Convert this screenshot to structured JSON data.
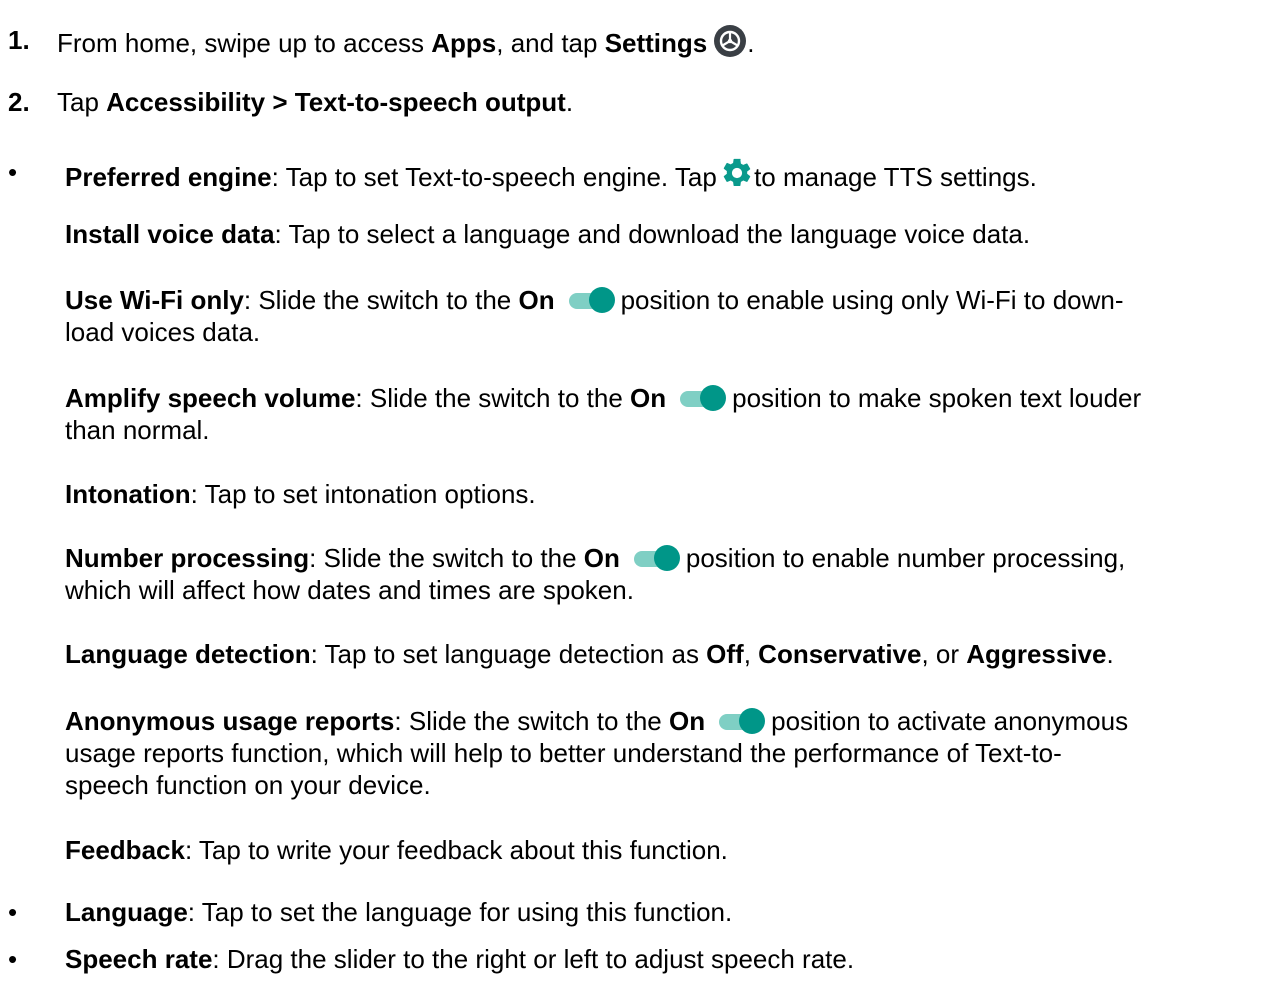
{
  "steps": [
    {
      "num": "1.",
      "pre": "From home, swipe up to access ",
      "b1": "Apps",
      "mid": ", and tap ",
      "b2": "Settings",
      "post": "."
    },
    {
      "num": "2.",
      "pre": "Tap ",
      "b1": "Accessibility > Text-to-speech output",
      "post": "."
    }
  ],
  "preferred": {
    "bullet": "•",
    "title": "Preferred engine",
    "text1": ": Tap to set Text-to-speech engine. Tap ",
    "text2": "to manage TTS settings."
  },
  "install": {
    "title": "Install voice data",
    "text": ": Tap to select a language and download the language voice data."
  },
  "wifi": {
    "title": "Use Wi-Fi only",
    "text1": ": Slide the switch to the ",
    "on": "On",
    "text2": "position to enable using only Wi-Fi to down-",
    "text3": "load voices data."
  },
  "amplify": {
    "title": "Amplify speech volume",
    "text1": ": Slide the switch to the ",
    "on": "On",
    "text2": "position to make spoken text louder",
    "text3": "than normal."
  },
  "intonation": {
    "title": "Intonation",
    "text": ": Tap to set intonation options."
  },
  "number": {
    "title": "Number processing",
    "text1": ": Slide the switch to the ",
    "on": "On",
    "text2": "position to enable number processing,",
    "text3": "which will affect how dates and times are spoken."
  },
  "langdetect": {
    "title": "Language detection",
    "text1": ": Tap to set language detection as ",
    "o1": "Off",
    "sep1": ", ",
    "o2": "Conservative",
    "sep2": ", or ",
    "o3": "Aggressive",
    "end": "."
  },
  "anon": {
    "title": "Anonymous usage reports",
    "text1": ": Slide the switch to the ",
    "on": "On",
    "text2": "position to activate anonymous",
    "text3": "usage reports function, which will help to better understand the performance of Text-to-",
    "text4": "speech function on your device."
  },
  "feedback": {
    "title": "Feedback",
    "text": ": Tap to write your feedback about this function."
  },
  "language": {
    "bullet": "•",
    "title": "Language",
    "text": ": Tap to set the language for using this function."
  },
  "speechrate": {
    "bullet": "•",
    "title": "Speech rate",
    "text": ": Drag the slider to the right or left to adjust speech rate."
  },
  "icons": {
    "settings": "settings-app-icon",
    "gear": "gear-icon",
    "toggle": "toggle-switch-icon"
  },
  "colors": {
    "toggle_track": "#7fcfc4",
    "toggle_knob": "#009688",
    "gear": "#0a9a8c",
    "settings_icon_bg": "#3a3f45"
  }
}
